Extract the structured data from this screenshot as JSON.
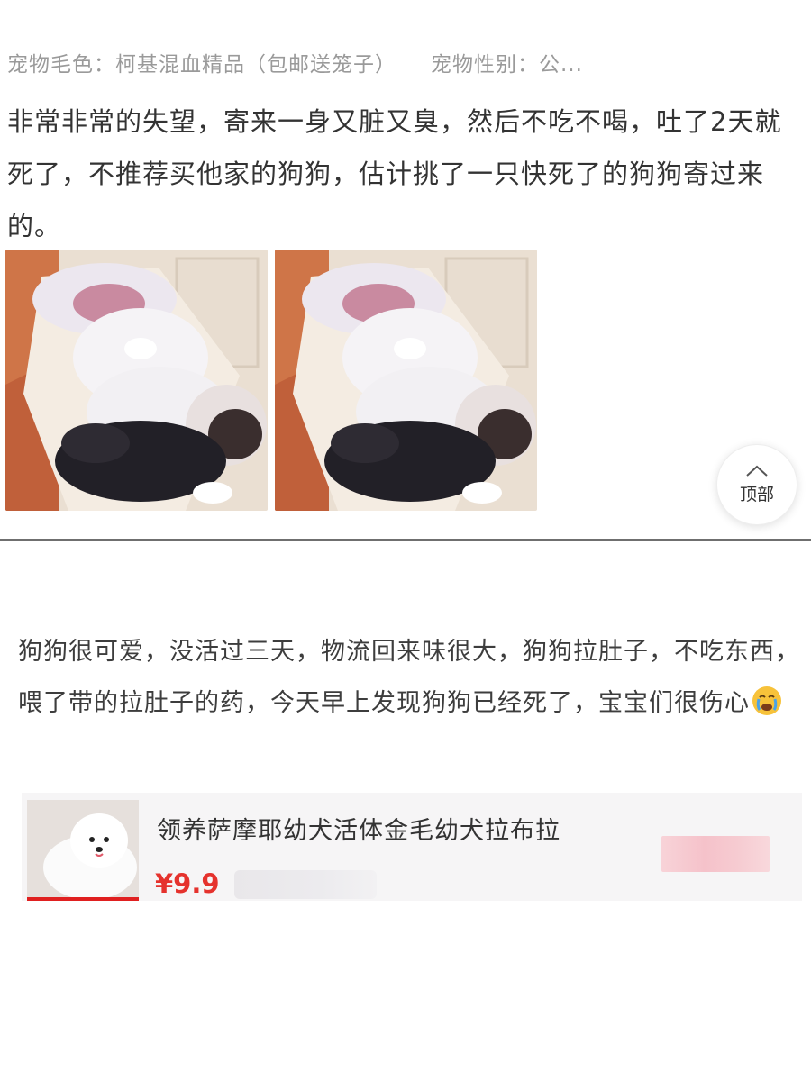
{
  "review1": {
    "meta_color": "宠物毛色：柯基混血精品（包邮送笼子）",
    "meta_gender": "宠物性别：公...",
    "text": "非常非常的失望，寄来一身又脏又臭，然后不吃不喝，吐了2天就死了，不推荐买他家的狗狗，估计挑了一只快死了的狗狗寄过来的。",
    "photos": [
      "dog-photo",
      "dog-photo"
    ],
    "back_to_top_label": "顶部"
  },
  "review2": {
    "text": "狗狗很可爱，没活过三天，物流回来味很大，狗狗拉肚子，不吃东西，喂了带的拉肚子的药，今天早上发现狗狗已经死了，宝宝们很伤心",
    "emoji": "crying-face-icon",
    "product": {
      "title": "领养萨摩耶幼犬活体金毛幼犬拉布拉",
      "price": "¥9.9"
    }
  },
  "colors": {
    "text": "#333333",
    "meta": "#9a9a9a",
    "price": "#e5322d",
    "divider": "#6f6f6f"
  }
}
